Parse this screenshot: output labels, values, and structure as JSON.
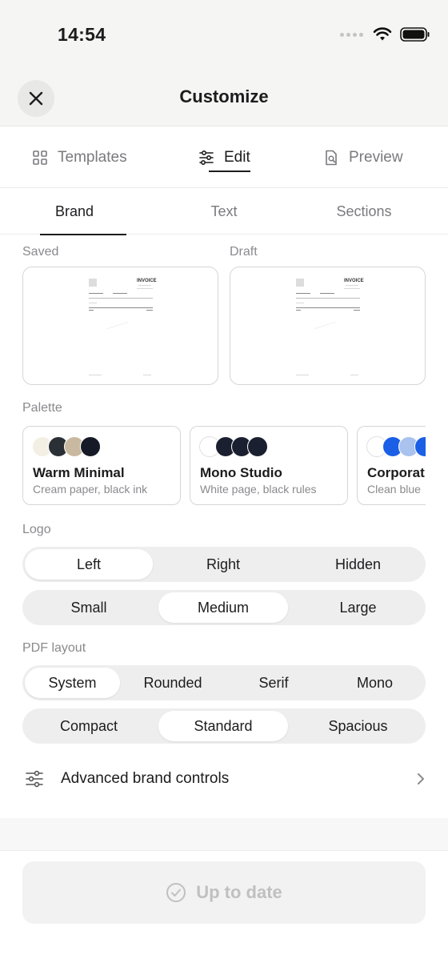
{
  "status": {
    "time": "14:54"
  },
  "nav": {
    "title": "Customize"
  },
  "top_tabs": [
    {
      "label": "Templates",
      "icon": "grid-icon"
    },
    {
      "label": "Edit",
      "icon": "sliders-icon",
      "active": true
    },
    {
      "label": "Preview",
      "icon": "document-search-icon"
    }
  ],
  "sub_tabs": [
    {
      "label": "Brand",
      "active": true
    },
    {
      "label": "Text"
    },
    {
      "label": "Sections"
    }
  ],
  "previews": {
    "saved_label": "Saved",
    "draft_label": "Draft",
    "invoice_title": "INVOICE"
  },
  "palette": {
    "label": "Palette",
    "items": [
      {
        "name": "Warm Minimal",
        "desc": "Cream paper, black ink",
        "colors": [
          "#f4efe4",
          "#2b2f36",
          "#c9b9a0",
          "#151a26"
        ]
      },
      {
        "name": "Mono Studio",
        "desc": "White page, black rules",
        "colors": [
          "#ffffff",
          "#1b2030",
          "#1b2030",
          "#1b2030"
        ]
      },
      {
        "name": "Corporat",
        "desc": "Clean blue",
        "colors": [
          "#ffffff",
          "#1a5fe6",
          "#a9c2ee",
          "#1a5fe6"
        ]
      }
    ]
  },
  "logo": {
    "label": "Logo",
    "position": {
      "options": [
        "Left",
        "Right",
        "Hidden"
      ],
      "selected": "Left"
    },
    "size": {
      "options": [
        "Small",
        "Medium",
        "Large"
      ],
      "selected": "Medium"
    }
  },
  "pdf_layout": {
    "label": "PDF layout",
    "font": {
      "options": [
        "System",
        "Rounded",
        "Serif",
        "Mono"
      ],
      "selected": "System"
    },
    "density": {
      "options": [
        "Compact",
        "Standard",
        "Spacious"
      ],
      "selected": "Standard"
    }
  },
  "advanced": {
    "label": "Advanced brand controls"
  },
  "footer": {
    "button_label": "Up to date"
  }
}
